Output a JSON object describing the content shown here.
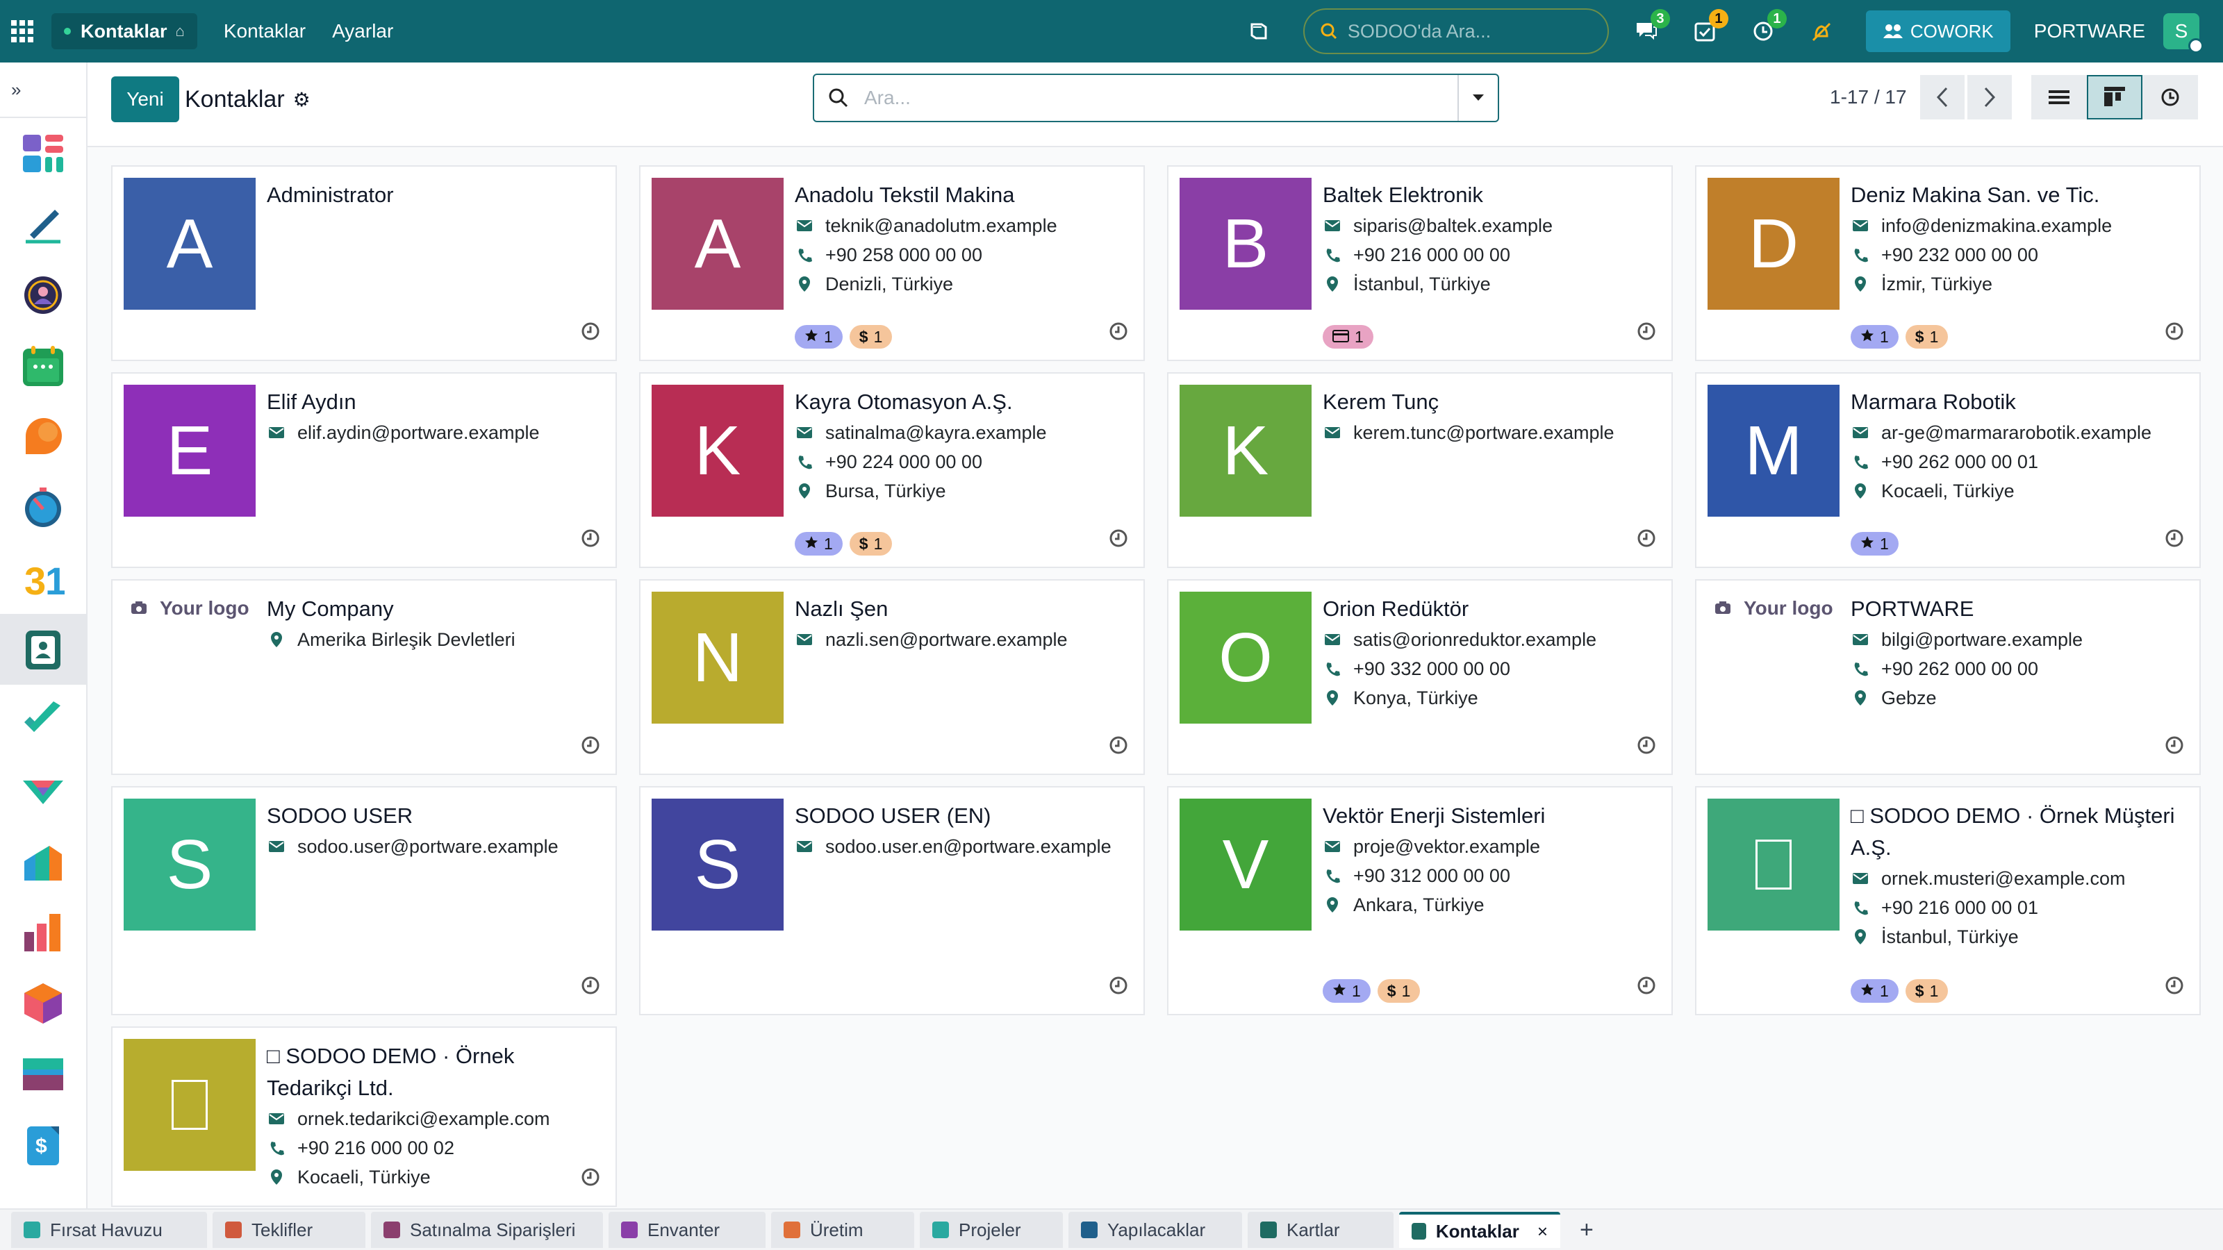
{
  "navbar": {
    "brand": "Kontaklar",
    "menu": [
      "Kontaklar",
      "Ayarlar"
    ],
    "search_placeholder": "SODOO'da Ara...",
    "badge_messages": "3",
    "badge_activities": "1",
    "badge_timers": "1",
    "cowork_label": "COWORK",
    "company": "PORTWARE",
    "user_initial": "S"
  },
  "control": {
    "new_label": "Yeni",
    "title": "Kontaklar",
    "search_placeholder": "Ara...",
    "pager": "1-17 / 17"
  },
  "sidebar": {
    "toggle": "»",
    "apps": [
      "dashboards",
      "sign",
      "crm-users",
      "calendar",
      "discuss",
      "timesheets",
      "calendar-31",
      "contacts",
      "todo",
      "crm",
      "sales",
      "manufacturing",
      "inventory",
      "purchase",
      "accounting"
    ]
  },
  "contacts": [
    {
      "name": "Administrator",
      "initial": "A",
      "color": "#3a5fa8",
      "email": "",
      "phone": "",
      "location": "",
      "tags": []
    },
    {
      "name": "Anadolu Tekstil Makina",
      "initial": "A",
      "color": "#a8436a",
      "email": "teknik@anadolutm.example",
      "phone": "+90 258 000 00 00",
      "location": "Denizli, Türkiye",
      "tags": [
        "star",
        "dollar"
      ]
    },
    {
      "name": "Baltek Elektronik",
      "initial": "B",
      "color": "#8a3ea6",
      "email": "siparis@baltek.example",
      "phone": "+90 216 000 00 00",
      "location": "İstanbul, Türkiye",
      "tags": [
        "card"
      ]
    },
    {
      "name": "Deniz Makina San. ve Tic.",
      "initial": "D",
      "color": "#c07f2a",
      "email": "info@denizmakina.example",
      "phone": "+90 232 000 00 00",
      "location": "İzmir, Türkiye",
      "tags": [
        "star",
        "dollar"
      ]
    },
    {
      "name": "Elif Aydın",
      "initial": "E",
      "color": "#8e2fb8",
      "email": "elif.aydin@portware.example",
      "phone": "",
      "location": "",
      "tags": []
    },
    {
      "name": "Kayra Otomasyon A.Ş.",
      "initial": "K",
      "color": "#b82d54",
      "email": "satinalma@kayra.example",
      "phone": "+90 224 000 00 00",
      "location": "Bursa, Türkiye",
      "tags": [
        "star",
        "dollar"
      ]
    },
    {
      "name": "Kerem Tunç",
      "initial": "K",
      "color": "#67a83f",
      "email": "kerem.tunc@portware.example",
      "phone": "",
      "location": "",
      "tags": []
    },
    {
      "name": "Marmara Robotik",
      "initial": "M",
      "color": "#2f56a8",
      "email": "ar-ge@marmararobotik.example",
      "phone": "+90 262 000 00 01",
      "location": "Kocaeli, Türkiye",
      "tags": [
        "star"
      ]
    },
    {
      "name": "My Company",
      "initial": "",
      "logo": "Your logo",
      "color": "",
      "email": "",
      "phone": "",
      "location": "Amerika Birleşik Devletleri",
      "tags": []
    },
    {
      "name": "Nazlı Şen",
      "initial": "N",
      "color": "#b9ab2e",
      "email": "nazli.sen@portware.example",
      "phone": "",
      "location": "",
      "tags": []
    },
    {
      "name": "Orion Redüktör",
      "initial": "O",
      "color": "#5bb03a",
      "email": "satis@orionreduktor.example",
      "phone": "+90 332 000 00 00",
      "location": "Konya, Türkiye",
      "tags": []
    },
    {
      "name": "PORTWARE",
      "initial": "",
      "logo": "Your logo",
      "color": "",
      "email": "bilgi@portware.example",
      "phone": "+90 262 000 00 00",
      "location": "Gebze",
      "tags": []
    },
    {
      "name": "SODOO USER",
      "initial": "S",
      "color": "#35b48a",
      "email": "sodoo.user@portware.example",
      "phone": "",
      "location": "",
      "tags": []
    },
    {
      "name": "SODOO USER (EN)",
      "initial": "S",
      "color": "#41459e",
      "email": "sodoo.user.en@portware.example",
      "phone": "",
      "location": "",
      "tags": []
    },
    {
      "name": "Vektör Enerji Sistemleri",
      "initial": "V",
      "color": "#43a63a",
      "email": "proje@vektor.example",
      "phone": "+90 312 000 00 00",
      "location": "Ankara, Türkiye",
      "tags": [
        "star",
        "dollar"
      ]
    },
    {
      "name": "□ SODOO DEMO · Örnek Müşteri A.Ş.",
      "initial": "□",
      "color": "#3ea87a",
      "email": "ornek.musteri@example.com",
      "phone": "+90 216 000 00 01",
      "location": "İstanbul, Türkiye",
      "tags": [
        "star",
        "dollar"
      ]
    },
    {
      "name": "□ SODOO DEMO · Örnek Tedarikçi Ltd.",
      "initial": "□",
      "color": "#b7ad2e",
      "email": "ornek.tedarikci@example.com",
      "phone": "+90 216 000 00 02",
      "location": "Kocaeli, Türkiye",
      "tags": []
    }
  ],
  "tag_labels": {
    "star": "1",
    "dollar": "1",
    "card": "1"
  },
  "tabs": [
    {
      "label": "Fırsat Havuzu",
      "color": "#2aa9a0"
    },
    {
      "label": "Teklifler",
      "color": "#d05a3e"
    },
    {
      "label": "Satınalma Siparişleri",
      "color": "#8b3f6e"
    },
    {
      "label": "Envanter",
      "color": "#8a3fa8"
    },
    {
      "label": "Üretim",
      "color": "#e0703a"
    },
    {
      "label": "Projeler",
      "color": "#2aa9a0"
    },
    {
      "label": "Yapılacaklar",
      "color": "#1f5f8b"
    },
    {
      "label": "Kartlar",
      "color": "#1f6b62"
    },
    {
      "label": "Kontaklar",
      "color": "#1f6b62",
      "active": true
    }
  ],
  "tab_close": "×",
  "tab_add": "+"
}
